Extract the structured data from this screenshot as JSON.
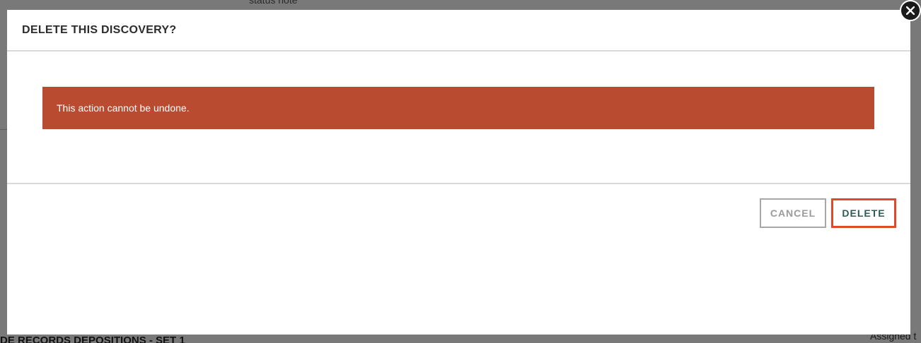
{
  "background": {
    "top_note": "status note",
    "bottom_heading": "DE RECORDS DEPOSITIONS - SET 1",
    "bottom_right": "Assigned t"
  },
  "modal": {
    "title": "DELETE THIS DISCOVERY?",
    "alert_message": "This action cannot be undone.",
    "cancel_label": "CANCEL",
    "delete_label": "DELETE"
  },
  "colors": {
    "alert_bg": "#b94b30",
    "delete_border": "#e04a2a",
    "delete_text": "#2f5a55"
  },
  "icons": {
    "close": "close-icon"
  }
}
